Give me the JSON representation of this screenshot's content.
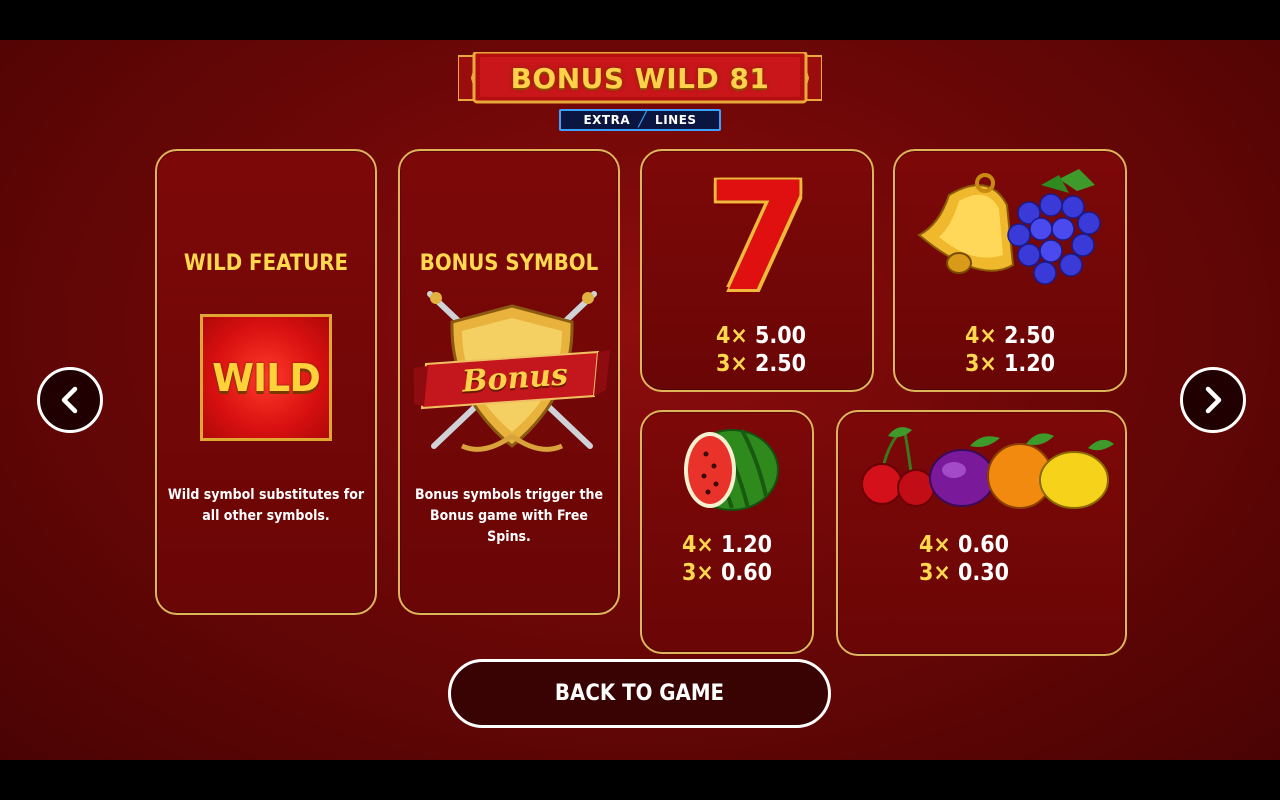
{
  "game": {
    "title": "BONUS WILD 81",
    "subtitle_left": "EXTRA",
    "subtitle_right": "LINES"
  },
  "cards": {
    "wild": {
      "title": "WILD FEATURE",
      "symbol_text": "WILD",
      "description": "Wild symbol substitutes for all other symbols."
    },
    "bonus": {
      "title": "BONUS SYMBOL",
      "symbol_text": "Bonus",
      "description": "Bonus symbols trigger the Bonus game with Free Spins."
    },
    "seven": {
      "symbol_text": "7",
      "pay4": "4×",
      "val4": " 5.00",
      "pay3": "3×",
      "val3": " 2.50"
    },
    "bell_grapes": {
      "pay4": "4×",
      "val4": " 2.50",
      "pay3": "3×",
      "val3": " 1.20"
    },
    "watermelon": {
      "pay4": "4×",
      "val4": " 1.20",
      "pay3": "3×",
      "val3": " 0.60"
    },
    "fruits": {
      "pay4": "4×",
      "val4": " 0.60",
      "pay3": "3×",
      "val3": " 0.30"
    }
  },
  "nav": {
    "prev_icon": "chevron-left-icon",
    "next_icon": "chevron-right-icon"
  },
  "back_label": "BACK TO GAME",
  "colors": {
    "gold": "#ffd84d",
    "border": "#e0b45a",
    "bg": "#6d0707"
  }
}
